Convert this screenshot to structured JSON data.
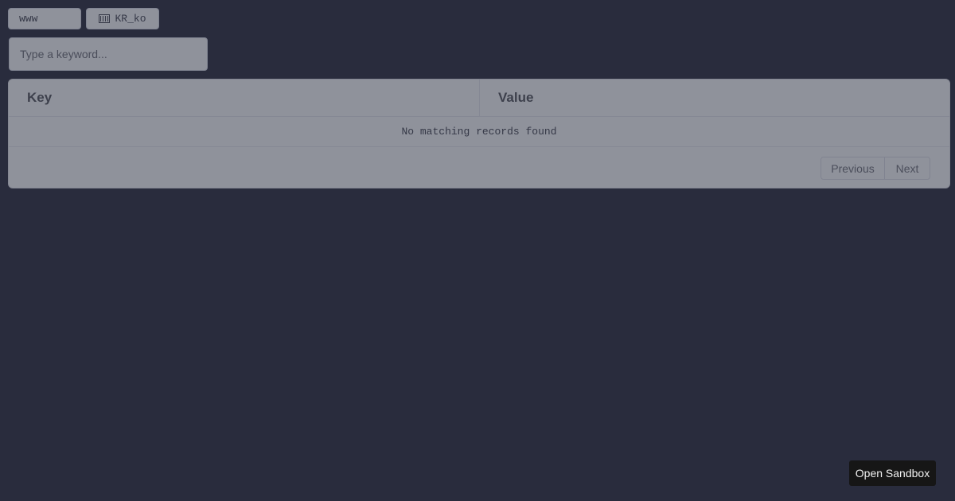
{
  "controls": {
    "environment": "www",
    "language": "KR_ko",
    "language_icon": "korean-flag-icon"
  },
  "search": {
    "placeholder": "Type a keyword..."
  },
  "table": {
    "columns": [
      "Key",
      "Value"
    ],
    "empty_message": "No matching records found"
  },
  "pagination": {
    "previous_label": "Previous",
    "next_label": "Next"
  },
  "footer": {
    "sandbox_label": "Open Sandbox"
  },
  "colors": {
    "page_background": "#292c3d",
    "panel_background": "#8f929b",
    "sandbox_button": "#161616"
  }
}
